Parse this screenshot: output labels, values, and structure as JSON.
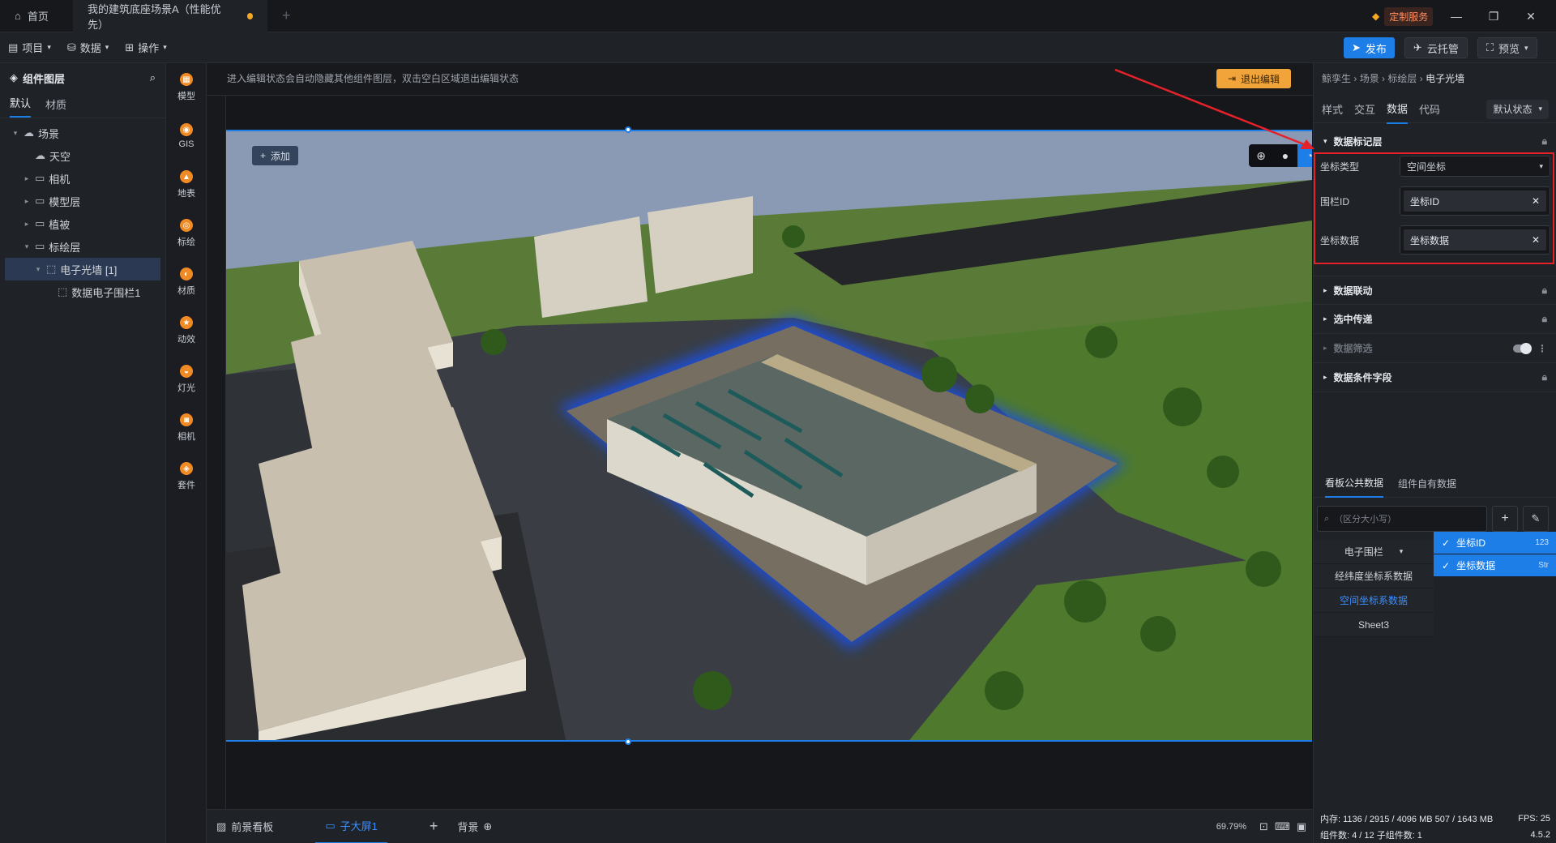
{
  "titlebar": {
    "home_tab": "首页",
    "project_tab": "我的建筑底座场景A（性能优先）",
    "custom_service": "定制服务"
  },
  "menubar": {
    "project": "项目",
    "data": "数据",
    "operation": "操作",
    "publish": "发布",
    "cloud_host": "云托管",
    "preview": "预览"
  },
  "layers": {
    "title": "组件图层",
    "tabs": [
      "默认",
      "材质"
    ],
    "tree": [
      {
        "label": "场景",
        "level": 0,
        "caret": "▾"
      },
      {
        "label": "天空",
        "level": 1,
        "caret": ""
      },
      {
        "label": "相机",
        "level": 1,
        "caret": "▸"
      },
      {
        "label": "模型层",
        "level": 1,
        "caret": "▸"
      },
      {
        "label": "植被",
        "level": 1,
        "caret": "▸"
      },
      {
        "label": "标绘层",
        "level": 1,
        "caret": "▾"
      },
      {
        "label": "电子光墙 [1]",
        "level": 2,
        "caret": "▾"
      },
      {
        "label": "数据电子围栏1",
        "level": 3,
        "caret": ""
      }
    ]
  },
  "tools": [
    "模型",
    "GIS",
    "地表",
    "标绘",
    "材质",
    "动效",
    "灯光",
    "相机",
    "套件"
  ],
  "canvas": {
    "hint": "进入编辑状态会自动隐藏其他组件图层，双击空白区域退出编辑状态",
    "exit_edit": "退出编辑",
    "add": "添加",
    "zoom": "69.79%"
  },
  "bottom": {
    "front_board": "前景看板",
    "sub_screen": "子大屏1",
    "background": "背景"
  },
  "props": {
    "breadcrumb": [
      "鲸孪生",
      "场景",
      "标绘层",
      "电子光墙"
    ],
    "tabs": [
      "样式",
      "交互",
      "数据",
      "代码"
    ],
    "state": "默认状态",
    "sections": {
      "data_layer": "数据标记层",
      "data_link": "数据联动",
      "select_pass": "选中传递",
      "data_filter": "数据筛选",
      "data_cond": "数据条件字段"
    },
    "coord_type_label": "坐标类型",
    "coord_type_value": "空间坐标",
    "fence_id_label": "围栏ID",
    "fence_id_tag": "坐标ID",
    "coord_data_label": "坐标数据",
    "coord_data_tag": "坐标数据"
  },
  "datasource": {
    "tabs": [
      "看板公共数据",
      "组件自有数据"
    ],
    "search_placeholder": "（区分大小写）",
    "sources": [
      "电子围栏",
      "经纬度坐标系数据",
      "空间坐标系数据",
      "Sheet3"
    ],
    "fields": [
      {
        "name": "坐标ID",
        "type": "123"
      },
      {
        "name": "坐标数据",
        "type": "Str"
      }
    ]
  },
  "status": {
    "memory": "内存: 1136 / 2915 / 4096 MB  507 / 1643 MB",
    "fps": "FPS: 25",
    "components": "组件数: 4 / 12  子组件数: 1",
    "version": "4.5.2"
  }
}
